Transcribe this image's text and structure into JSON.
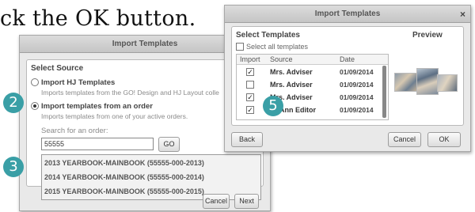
{
  "instruction": "ck the OK button.",
  "left_dialog": {
    "title": "Import Templates",
    "section_heading": "Select Source",
    "option1_label": "Import HJ Templates",
    "option1_desc": "Imports templates from the GO! Design and HJ Layout colle",
    "option2_label": "Import templates from an order",
    "option2_desc": "Imports templates from one of your active orders.",
    "search_label": "Search for an order:",
    "search_value": "55555",
    "go_label": "GO",
    "results": [
      "2013 YEARBOOK-MAINBOOK (55555-000-2013)",
      "2014 YEARBOOK-MAINBOOK (55555-000-2014)",
      "2015 YEARBOOK-MAINBOOK (55555-000-2015)"
    ],
    "cancel_label": "Cancel",
    "next_label": "Next"
  },
  "right_dialog": {
    "title": "Import Templates",
    "close_glyph": "×",
    "section_heading": "Select Templates",
    "preview_label": "Preview",
    "select_all_label": "Select all templates",
    "columns": {
      "import": "Import",
      "source": "Source",
      "date": "Date"
    },
    "rows": [
      {
        "checked": true,
        "source": "Mrs. Adviser",
        "date": "01/09/2014"
      },
      {
        "checked": false,
        "source": "Mrs. Adviser",
        "date": "01/09/2014"
      },
      {
        "checked": true,
        "source": "Mrs. Adviser",
        "date": "01/09/2014"
      },
      {
        "checked": true,
        "source": "Ann Editor",
        "date": "01/09/2014"
      }
    ],
    "back_label": "Back",
    "cancel_label": "Cancel",
    "ok_label": "OK"
  },
  "badges": {
    "two": "2",
    "three": "3",
    "five": "5"
  },
  "check_glyph": "✓",
  "colors": {
    "badge": "#3a9fa6"
  }
}
